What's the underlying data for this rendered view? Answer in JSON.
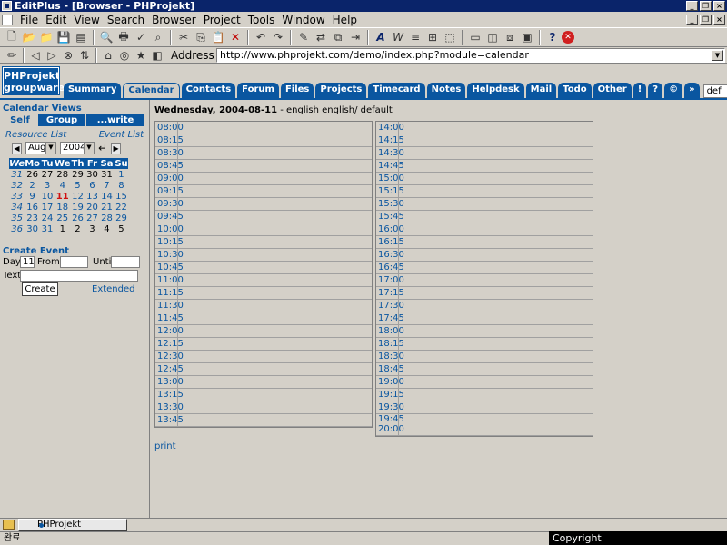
{
  "window": {
    "title": "EditPlus - [Browser - PHProjekt]"
  },
  "menu": [
    "File",
    "Edit",
    "View",
    "Search",
    "Browser",
    "Project",
    "Tools",
    "Window",
    "Help"
  ],
  "address": {
    "label": "Address",
    "url": "http://www.phprojekt.com/demo/index.php?module=calendar"
  },
  "logo": {
    "line1": "PHProjekt",
    "line2": "groupware"
  },
  "tabs": [
    "Summary",
    "Calendar",
    "Contacts",
    "Forum",
    "Files",
    "Projects",
    "Timecard",
    "Notes",
    "Helpdesk",
    "Mail",
    "Todo",
    "Other",
    "!",
    "?",
    "©",
    "»"
  ],
  "active_tab": "Calendar",
  "theme_select": "def",
  "sidebar": {
    "title": "Calendar Views",
    "views": [
      "Self",
      "Group",
      "...write"
    ],
    "resource_link": "Resource List",
    "event_link": "Event List",
    "month": "Aug",
    "year": "2004",
    "weekdays": [
      "We",
      "Mo",
      "Tu",
      "We",
      "Th",
      "Fr",
      "Sa",
      "Su"
    ],
    "weeks": [
      [
        "31",
        "26",
        "27",
        "28",
        "29",
        "30",
        "31",
        "1"
      ],
      [
        "32",
        "2",
        "3",
        "4",
        "5",
        "6",
        "7",
        "8"
      ],
      [
        "33",
        "9",
        "10",
        "11",
        "12",
        "13",
        "14",
        "15"
      ],
      [
        "34",
        "16",
        "17",
        "18",
        "19",
        "20",
        "21",
        "22"
      ],
      [
        "35",
        "23",
        "24",
        "25",
        "26",
        "27",
        "28",
        "29"
      ],
      [
        "36",
        "30",
        "31",
        "1",
        "2",
        "3",
        "4",
        "5"
      ]
    ],
    "today": "11",
    "create": {
      "title": "Create Event",
      "day_label": "Day:",
      "day_value": "11",
      "from_label": "From:",
      "until_label": "Until:",
      "text_label": "Text:",
      "create_button": "Create",
      "extended_link": "Extended"
    }
  },
  "main": {
    "date": "Wednesday, 2004-08-11",
    "date_suffix": " - english english/ default",
    "left_slots": [
      "08:00",
      "08:15",
      "08:30",
      "08:45",
      "09:00",
      "09:15",
      "09:30",
      "09:45",
      "10:00",
      "10:15",
      "10:30",
      "10:45",
      "11:00",
      "11:15",
      "11:30",
      "11:45",
      "12:00",
      "12:15",
      "12:30",
      "12:45",
      "13:00",
      "13:15",
      "13:30",
      "13:45"
    ],
    "right_slots": [
      "14:00",
      "14:15",
      "14:30",
      "14:45",
      "15:00",
      "15:15",
      "15:30",
      "15:45",
      "16:00",
      "16:15",
      "16:30",
      "16:45",
      "17:00",
      "17:15",
      "17:30",
      "17:45",
      "18:00",
      "18:15",
      "18:30",
      "18:45",
      "19:00",
      "19:15",
      "19:30"
    ],
    "last_slot_line1": "19:45",
    "last_slot_line2": "20:00",
    "print_link": "print"
  },
  "taskbar": {
    "item": "PHProjekt"
  },
  "status": {
    "text": "완료",
    "copyright": "Copyright  http://www.happycgi.com"
  }
}
